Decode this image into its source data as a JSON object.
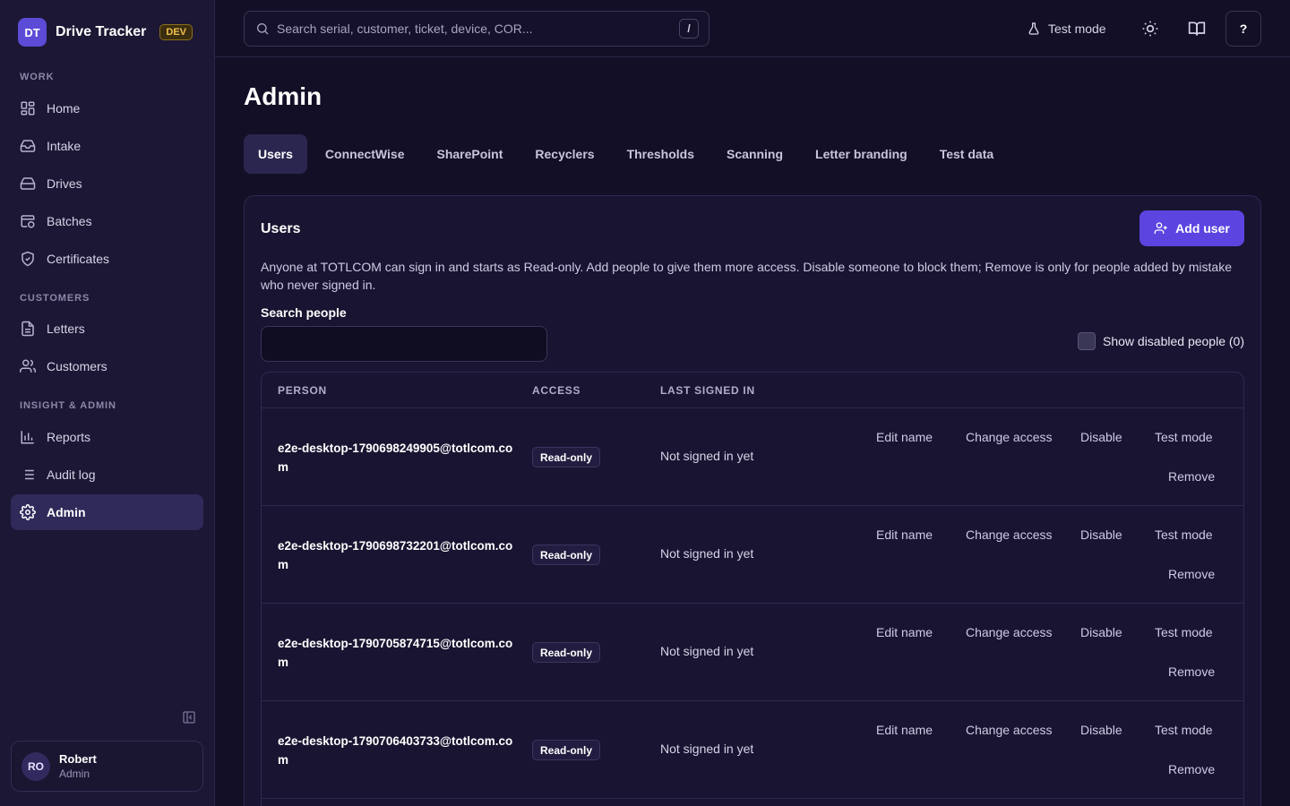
{
  "app": {
    "logo_initials": "DT",
    "name": "Drive Tracker",
    "env_badge": "DEV"
  },
  "sidebar": {
    "sections": [
      {
        "label": "WORK",
        "items": [
          {
            "label": "Home",
            "icon": "home-icon"
          },
          {
            "label": "Intake",
            "icon": "inbox-icon"
          },
          {
            "label": "Drives",
            "icon": "hard-drive-icon"
          },
          {
            "label": "Batches",
            "icon": "package-icon"
          },
          {
            "label": "Certificates",
            "icon": "shield-check-icon"
          }
        ]
      },
      {
        "label": "CUSTOMERS",
        "items": [
          {
            "label": "Letters",
            "icon": "file-text-icon"
          },
          {
            "label": "Customers",
            "icon": "users-icon"
          }
        ]
      },
      {
        "label": "INSIGHT & ADMIN",
        "items": [
          {
            "label": "Reports",
            "icon": "bar-chart-icon"
          },
          {
            "label": "Audit log",
            "icon": "list-icon"
          },
          {
            "label": "Admin",
            "icon": "gear-icon",
            "active": true
          }
        ]
      }
    ],
    "user": {
      "initials": "RO",
      "name": "Robert",
      "role": "Admin"
    }
  },
  "topbar": {
    "search_placeholder": "Search serial, customer, ticket, device, COR...",
    "search_shortcut": "/",
    "test_mode_label": "Test mode",
    "help_label": "?"
  },
  "page": {
    "title": "Admin",
    "tabs": [
      "Users",
      "ConnectWise",
      "SharePoint",
      "Recyclers",
      "Thresholds",
      "Scanning",
      "Letter branding",
      "Test data"
    ],
    "active_tab": "Users"
  },
  "users_card": {
    "title": "Users",
    "add_user_label": "Add user",
    "description": "Anyone at TOTLCOM can sign in and starts as Read-only. Add people to give them more access. Disable someone to block them; Remove is only for people added by mistake who never signed in.",
    "search_label": "Search people",
    "search_value": "",
    "show_disabled_label": "Show disabled people (0)",
    "columns": [
      "PERSON",
      "ACCESS",
      "LAST SIGNED IN"
    ],
    "rows": [
      {
        "person": "e2e-desktop-1790698249905@totlcom.com",
        "access": "Read-only",
        "last_signed_in": "Not signed in yet"
      },
      {
        "person": "e2e-desktop-1790698732201@totlcom.com",
        "access": "Read-only",
        "last_signed_in": "Not signed in yet"
      },
      {
        "person": "e2e-desktop-1790705874715@totlcom.com",
        "access": "Read-only",
        "last_signed_in": "Not signed in yet"
      },
      {
        "person": "e2e-desktop-1790706403733@totlcom.com",
        "access": "Read-only",
        "last_signed_in": "Not signed in yet"
      }
    ],
    "row_actions": [
      "Edit name",
      "Change access",
      "Disable",
      "Test mode",
      "Remove"
    ]
  },
  "colors": {
    "background": "#130f26",
    "sidebar": "#1c1734",
    "accent": "#5b44e0",
    "active_nav": "#2f2a5a",
    "dev_badge": "#f0c04a"
  }
}
